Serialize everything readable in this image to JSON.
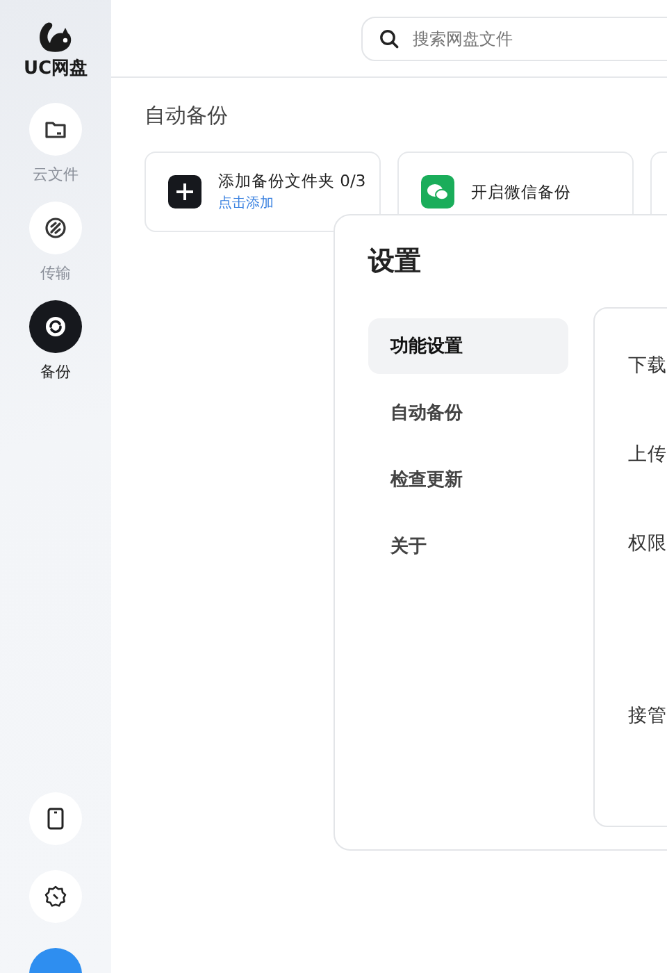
{
  "app": {
    "logo_text": "UC网盘"
  },
  "sidebar": {
    "items": [
      {
        "label": "云文件",
        "kind": "folder",
        "selected": false
      },
      {
        "label": "传输",
        "kind": "transfer",
        "selected": false
      },
      {
        "label": "备份",
        "kind": "sync",
        "selected": true
      }
    ],
    "bottom_buttons": [
      {
        "kind": "phone"
      },
      {
        "kind": "gear"
      }
    ]
  },
  "search": {
    "placeholder": "搜索网盘文件"
  },
  "page": {
    "title": "自动备份",
    "cards": [
      {
        "kind": "add",
        "title": "添加备份文件夹 0/3",
        "link": "点击添加"
      },
      {
        "kind": "wechat",
        "title": "开启微信备份"
      },
      {
        "kind": "blank"
      }
    ]
  },
  "dialog": {
    "title": "设置",
    "menu": [
      {
        "label": "功能设置",
        "selected": true
      },
      {
        "label": "自动备份",
        "selected": false
      },
      {
        "label": "检查更新",
        "selected": false
      },
      {
        "label": "关于",
        "selected": false
      }
    ],
    "settings": [
      {
        "label": "下载",
        "kind": "short"
      },
      {
        "label": "上传",
        "kind": "short"
      },
      {
        "label": "权限",
        "kind": "tall"
      },
      {
        "label": "接管",
        "kind": "short"
      }
    ]
  }
}
